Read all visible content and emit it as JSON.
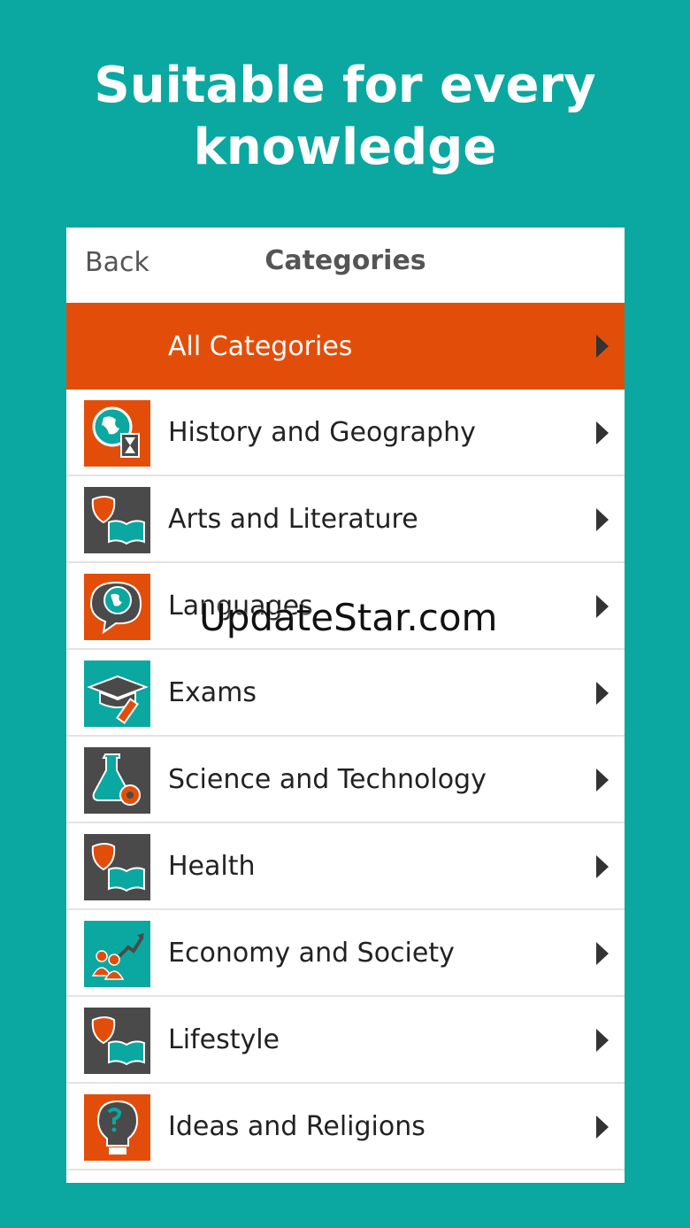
{
  "promo": {
    "line1": "Suitable for every",
    "line2": "knowledge"
  },
  "navbar": {
    "back_label": "Back",
    "title": "Categories"
  },
  "categories": [
    {
      "label": "All Categories",
      "icon": "none",
      "icon_bg": "#e24e0a"
    },
    {
      "label": "History and Geography",
      "icon": "globe-hourglass-icon",
      "icon_bg": "#e24e0a"
    },
    {
      "label": "Arts and Literature",
      "icon": "mask-book-icon",
      "icon_bg": "#4a4a4a"
    },
    {
      "label": "Languages",
      "icon": "speech-globe-icon",
      "icon_bg": "#e24e0a"
    },
    {
      "label": "Exams",
      "icon": "graduation-cap-icon",
      "icon_bg": "#0aa8a0"
    },
    {
      "label": "Science and Technology",
      "icon": "flask-gear-icon",
      "icon_bg": "#4a4a4a"
    },
    {
      "label": "Health",
      "icon": "mask-book-icon",
      "icon_bg": "#4a4a4a"
    },
    {
      "label": "Economy and Society",
      "icon": "people-chart-icon",
      "icon_bg": "#0aa8a0"
    },
    {
      "label": "Lifestyle",
      "icon": "mask-book-icon",
      "icon_bg": "#4a4a4a"
    },
    {
      "label": "Ideas and Religions",
      "icon": "lightbulb-icon",
      "icon_bg": "#e24e0a"
    }
  ],
  "watermark": "UpdateStar.com",
  "colors": {
    "background": "#0aa8a0",
    "accent": "#e24e0a",
    "dark": "#4a4a4a"
  }
}
